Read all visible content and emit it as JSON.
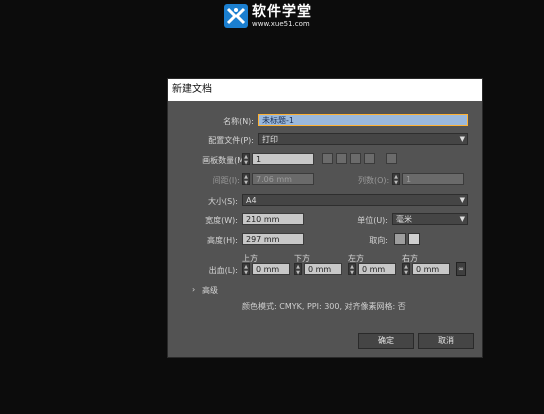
{
  "watermark": {
    "title": "软件学堂",
    "url": "www.xue51.com"
  },
  "dialog": {
    "title": "新建文档",
    "name_label": "名称(N):",
    "name_value": "未标题-1",
    "profile_label": "配置文件(P):",
    "profile_value": "打印",
    "artboards_label": "画板数量(M):",
    "artboards_value": "1",
    "spacing_label": "间距(I):",
    "spacing_value": "7.06 mm",
    "columns_label": "列数(O):",
    "columns_value": "1",
    "size_label": "大小(S):",
    "size_value": "A4",
    "width_label": "宽度(W):",
    "width_value": "210 mm",
    "units_label": "单位(U):",
    "units_value": "毫米",
    "height_label": "高度(H):",
    "height_value": "297 mm",
    "orientation_label": "取向:",
    "bleed_label": "出血(L):",
    "bleed_top_label": "上方",
    "bleed_bottom_label": "下方",
    "bleed_left_label": "左方",
    "bleed_right_label": "右方",
    "bleed_top": "0 mm",
    "bleed_bottom": "0 mm",
    "bleed_left": "0 mm",
    "bleed_right": "0 mm",
    "advanced_label": "高级",
    "info": "颜色模式: CMYK, PPI: 300, 对齐像素网格: 否",
    "ok_label": "确定",
    "cancel_label": "取消"
  }
}
